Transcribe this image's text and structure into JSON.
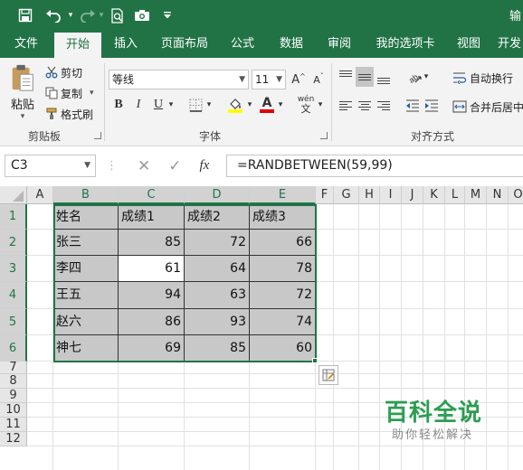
{
  "window": {
    "title_partial": "输"
  },
  "quick_access": {
    "save_icon": "save-icon",
    "undo_icon": "undo-icon",
    "redo_icon": "redo-icon",
    "print_preview_icon": "print-preview-icon",
    "camera_icon": "camera-icon",
    "customize_icon": "customize-qat-icon"
  },
  "tabs": [
    {
      "label": "文件",
      "active": false
    },
    {
      "label": "开始",
      "active": true
    },
    {
      "label": "插入",
      "active": false
    },
    {
      "label": "页面布局",
      "active": false
    },
    {
      "label": "公式",
      "active": false
    },
    {
      "label": "数据",
      "active": false
    },
    {
      "label": "审阅",
      "active": false
    },
    {
      "label": "我的选项卡",
      "active": false
    },
    {
      "label": "视图",
      "active": false
    },
    {
      "label": "开发",
      "active": false
    }
  ],
  "ribbon": {
    "clipboard": {
      "group_label": "剪贴板",
      "paste": "粘贴",
      "cut": "剪切",
      "copy": "复制",
      "format_painter": "格式刷"
    },
    "font": {
      "group_label": "字体",
      "font_name": "等线",
      "font_size": "11",
      "bold": "B",
      "italic": "I",
      "underline": "U",
      "wen": "wén",
      "font_color": "A",
      "grow": "A",
      "shrink": "A",
      "highlight_color": "#ffff00",
      "text_color": "#e00000"
    },
    "alignment": {
      "group_label": "对齐方式",
      "wrap_text": "自动换行",
      "merge_center": "合并后居中"
    }
  },
  "formula_bar": {
    "name_box": "C3",
    "fx": "fx",
    "formula": "=RANDBETWEEN(59,99)",
    "cancel_icon": "cancel-icon",
    "enter_icon": "check-icon"
  },
  "sheet": {
    "columns": [
      "A",
      "B",
      "C",
      "D",
      "E",
      "F",
      "G",
      "H",
      "I",
      "J",
      "K",
      "L",
      "M",
      "N",
      "O"
    ],
    "rows": [
      "1",
      "2",
      "3",
      "4",
      "5",
      "6",
      "7",
      "8",
      "9",
      "10",
      "11",
      "12"
    ],
    "header": [
      "姓名",
      "成绩1",
      "成绩2",
      "成绩3"
    ],
    "data": [
      [
        "张三",
        "85",
        "72",
        "66"
      ],
      [
        "李四",
        "61",
        "64",
        "78"
      ],
      [
        "王五",
        "94",
        "63",
        "72"
      ],
      [
        "赵六",
        "86",
        "93",
        "74"
      ],
      [
        "神七",
        "69",
        "85",
        "60"
      ]
    ],
    "active_cell": "C3",
    "selection_fill": "#c8c8c8",
    "accent": "#217346"
  },
  "watermark": {
    "title": "百科全说",
    "subtitle": "助你轻松解决"
  }
}
